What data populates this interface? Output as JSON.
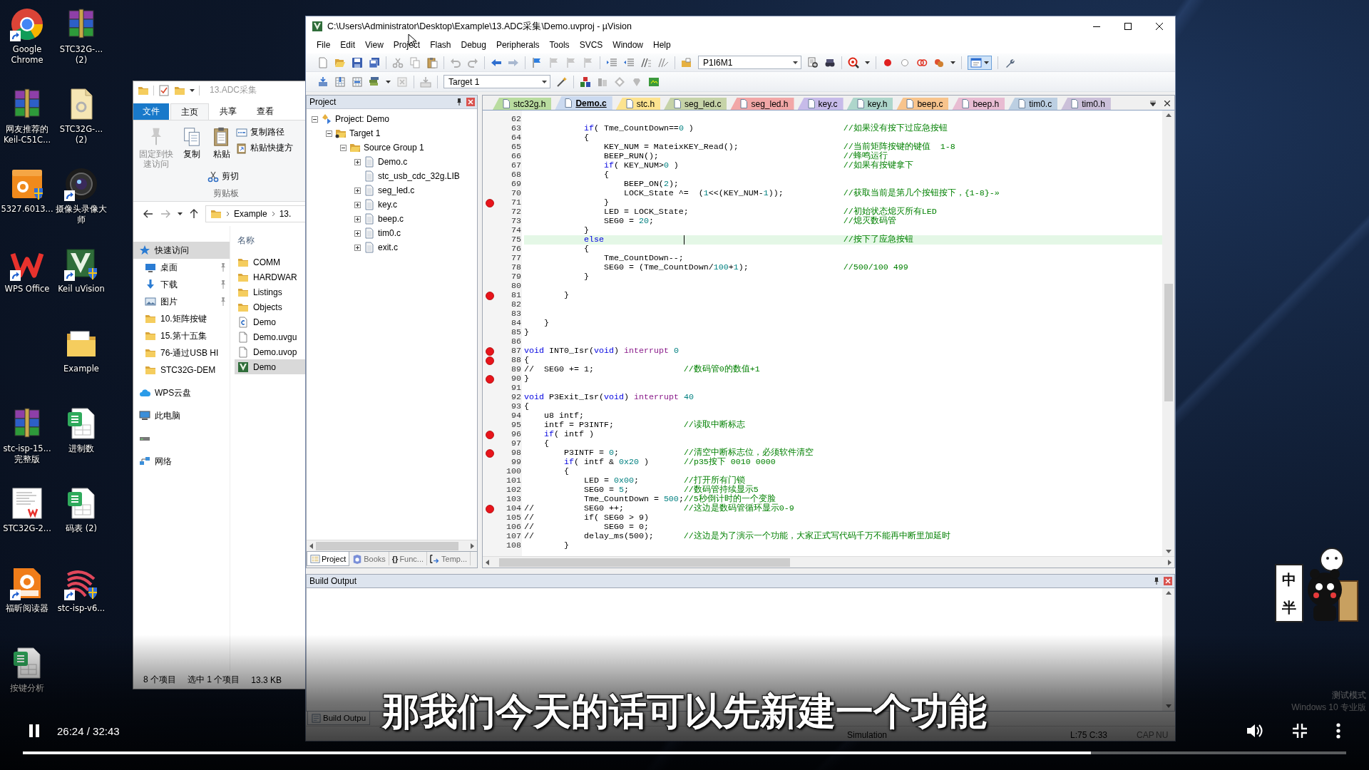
{
  "desktop": {
    "columns": [
      [
        {
          "label": "Google Chrome",
          "kind": "browser",
          "shortcut": true
        },
        {
          "label": "网友推荐的Keil-C51C...",
          "kind": "archive",
          "shortcut": false
        },
        {
          "label": "5327.6013...",
          "kind": "pdf-package",
          "shortcut": false
        },
        {
          "label": "WPS Office",
          "kind": "office",
          "shortcut": true
        },
        {
          "label": "stc-isp-15...完整版",
          "kind": "archive",
          "shortcut": false
        },
        {
          "label": "STC32G-2...",
          "kind": "pdf-document",
          "shortcut": false
        },
        {
          "label": "福昕阅读器",
          "kind": "reader",
          "shortcut": true
        },
        {
          "label": "按键分析",
          "kind": "spreadsheet",
          "shortcut": false
        }
      ],
      [
        {
          "label": "STC32G-... (2)",
          "kind": "archive",
          "shortcut": false
        },
        {
          "label": "STC32G-... (2)",
          "kind": "document",
          "shortcut": false
        },
        {
          "label": "摄像头录像大师",
          "kind": "camera",
          "shortcut": true
        },
        {
          "label": "Keil uVision",
          "kind": "ide",
          "shortcut": true
        },
        {
          "label": "Example",
          "kind": "folder",
          "shortcut": false
        },
        {
          "label": "进制数",
          "kind": "spreadsheet",
          "shortcut": false
        },
        {
          "label": "码表 (2)",
          "kind": "spreadsheet",
          "shortcut": false
        },
        {
          "label": "stc-isp-v6...",
          "kind": "tool",
          "shortcut": true
        }
      ]
    ],
    "os_notice": [
      "测试模式",
      "Windows 10 专业版"
    ]
  },
  "explorer": {
    "title": "13.ADC采集",
    "ribbon_tabs": [
      {
        "label": "文件",
        "kind": "menu",
        "selected": false
      },
      {
        "label": "主页",
        "kind": "tab",
        "selected": true
      },
      {
        "label": "共享",
        "kind": "tab",
        "selected": false
      },
      {
        "label": "查看",
        "kind": "tab",
        "selected": false
      }
    ],
    "ribbon": {
      "large": [
        {
          "label": "固定到快速访问",
          "kind": "pin",
          "disabled": true
        },
        {
          "label": "复制",
          "kind": "copy",
          "disabled": false
        },
        {
          "label": "粘贴",
          "kind": "paste",
          "disabled": false
        }
      ],
      "small": [
        {
          "label": "复制路径",
          "kind": "copy-path"
        },
        {
          "label": "粘贴快捷方",
          "kind": "paste-shortcut"
        },
        {
          "label": "剪切",
          "kind": "cut"
        }
      ],
      "group": "剪贴板"
    },
    "address": [
      "Example",
      "13."
    ],
    "nav": [
      {
        "label": "快速访问",
        "kind": "star",
        "selected": true,
        "children": [
          {
            "label": "桌面",
            "kind": "desktop",
            "pinned": true,
            "selected": false
          },
          {
            "label": "下载",
            "kind": "download",
            "pinned": true,
            "selected": false
          },
          {
            "label": "图片",
            "kind": "pictures",
            "pinned": true,
            "selected": false
          },
          {
            "label": "10.矩阵按键",
            "kind": "folder",
            "pinned": false,
            "selected": false
          },
          {
            "label": "15.第十五集",
            "kind": "folder",
            "pinned": false,
            "selected": false
          },
          {
            "label": "76-通过USB HI",
            "kind": "folder",
            "pinned": false,
            "selected": false
          },
          {
            "label": "STC32G-DEM",
            "kind": "folder",
            "pinned": false,
            "selected": false
          }
        ]
      },
      {
        "label": "WPS云盘",
        "kind": "cloud",
        "selected": false
      },
      {
        "label": "此电脑",
        "kind": "computer",
        "selected": false
      },
      {
        "kind": "drive",
        "selected": false
      },
      {
        "label": "网络",
        "kind": "network",
        "selected": false
      }
    ],
    "column": "名称",
    "files": [
      {
        "name": "COMM",
        "kind": "folder",
        "selected": false
      },
      {
        "name": "HARDWAR",
        "kind": "folder",
        "selected": false
      },
      {
        "name": "Listings",
        "kind": "folder",
        "selected": false
      },
      {
        "name": "Objects",
        "kind": "folder",
        "selected": false
      },
      {
        "name": "Demo",
        "kind": "c-source",
        "selected": false
      },
      {
        "name": "Demo.uvgu",
        "kind": "file",
        "selected": false
      },
      {
        "name": "Demo.uvop",
        "kind": "file",
        "selected": false
      },
      {
        "name": "Demo",
        "kind": "project",
        "selected": true
      }
    ],
    "status": [
      "8 个项目",
      "选中 1 个项目",
      "13.3 KB"
    ]
  },
  "uvision": {
    "title": "C:\\Users\\Administrator\\Desktop\\Example\\13.ADC采集\\Demo.uvproj - µVision",
    "menu": [
      "File",
      "Edit",
      "View",
      "Project",
      "Flash",
      "Debug",
      "Peripherals",
      "Tools",
      "SVCS",
      "Window",
      "Help"
    ],
    "toolbar": {
      "device": "P1I6M1",
      "target": "Target 1",
      "layout_pressed": true
    },
    "project": {
      "title": "Project",
      "tree": [
        {
          "label": "Project: Demo",
          "kind": "project",
          "expanded": true,
          "children": [
            {
              "label": "Target 1",
              "kind": "target",
              "expanded": true,
              "children": [
                {
                  "label": "Source Group 1",
                  "kind": "group",
                  "expanded": true,
                  "children": [
                    {
                      "label": "Demo.c",
                      "kind": "file",
                      "expandable": true,
                      "expanded": false
                    },
                    {
                      "label": "stc_usb_cdc_32g.LIB",
                      "kind": "file",
                      "expandable": false
                    },
                    {
                      "label": "seg_led.c",
                      "kind": "file",
                      "expandable": true,
                      "expanded": false
                    },
                    {
                      "label": "key.c",
                      "kind": "file",
                      "expandable": true,
                      "expanded": false
                    },
                    {
                      "label": "beep.c",
                      "kind": "file",
                      "expandable": true,
                      "expanded": false
                    },
                    {
                      "label": "tim0.c",
                      "kind": "file",
                      "expandable": true,
                      "expanded": false
                    },
                    {
                      "label": "exit.c",
                      "kind": "file",
                      "expandable": true,
                      "expanded": false
                    }
                  ]
                }
              ]
            }
          ]
        }
      ],
      "tabs": [
        {
          "label": "Project",
          "kind": "project",
          "selected": true
        },
        {
          "label": "Books",
          "kind": "books",
          "selected": false
        },
        {
          "label": "Func...",
          "kind": "functions",
          "glyph": "{}",
          "selected": false
        },
        {
          "label": "Temp...",
          "kind": "templates",
          "selected": false
        }
      ]
    },
    "editor": {
      "tabs": [
        {
          "label": "stc32g.h",
          "color": "#b9dc9f",
          "selected": false
        },
        {
          "label": "Demo.c",
          "color": "#cbdaf0",
          "selected": true
        },
        {
          "label": "stc.h",
          "color": "#fde38f",
          "selected": false
        },
        {
          "label": "seg_led.c",
          "color": "#c6d3a8",
          "selected": false
        },
        {
          "label": "seg_led.h",
          "color": "#f2a7a7",
          "selected": false
        },
        {
          "label": "key.c",
          "color": "#c7bbe9",
          "selected": false
        },
        {
          "label": "key.h",
          "color": "#aed6cb",
          "selected": false
        },
        {
          "label": "beep.c",
          "color": "#f8c48c",
          "selected": false
        },
        {
          "label": "beep.h",
          "color": "#e8bcd2",
          "selected": false
        },
        {
          "label": "tim0.c",
          "color": "#bccfe2",
          "selected": false
        },
        {
          "label": "tim0.h",
          "color": "#cbc0d9",
          "selected": false
        }
      ],
      "lines": [
        {
          "number": "62",
          "breakpoint": false,
          "current": false
        },
        {
          "number": "63",
          "breakpoint": false,
          "current": false,
          "tokens": [
            {
              "kind": "keyword",
              "text": "            if"
            },
            {
              "kind": "plain",
              "text": "( Tme_CountDown=="
            },
            {
              "kind": "number",
              "text": "0"
            },
            {
              "kind": "plain",
              "text": " )                              "
            },
            {
              "kind": "comment",
              "text": "//如果没有按下过应急按钮"
            }
          ]
        },
        {
          "number": "64",
          "breakpoint": false,
          "current": false,
          "tokens": [
            {
              "kind": "plain",
              "text": "            {"
            }
          ]
        },
        {
          "number": "65",
          "breakpoint": false,
          "current": false,
          "tokens": [
            {
              "kind": "plain",
              "text": "                KEY_NUM = MateixKEY_Read();                     "
            },
            {
              "kind": "comment",
              "text": "//当前矩阵按键的键值  1-8"
            }
          ]
        },
        {
          "number": "66",
          "breakpoint": false,
          "current": false,
          "tokens": [
            {
              "kind": "plain",
              "text": "                BEEP_RUN();                                     "
            },
            {
              "kind": "comment",
              "text": "//蜂鸣运行"
            }
          ]
        },
        {
          "number": "67",
          "breakpoint": false,
          "current": false,
          "tokens": [
            {
              "kind": "keyword",
              "text": "                if"
            },
            {
              "kind": "plain",
              "text": "( KEY_NUM>"
            },
            {
              "kind": "number",
              "text": "0"
            },
            {
              "kind": "plain",
              "text": " )                                 "
            },
            {
              "kind": "comment",
              "text": "//如果有按键拿下"
            }
          ]
        },
        {
          "number": "68",
          "breakpoint": false,
          "current": false,
          "tokens": [
            {
              "kind": "plain",
              "text": "                {"
            }
          ]
        },
        {
          "number": "69",
          "breakpoint": false,
          "current": false,
          "tokens": [
            {
              "kind": "plain",
              "text": "                    BEEP_ON("
            },
            {
              "kind": "number",
              "text": "2"
            },
            {
              "kind": "plain",
              "text": ");"
            }
          ]
        },
        {
          "number": "70",
          "breakpoint": false,
          "current": false,
          "tokens": [
            {
              "kind": "plain",
              "text": "                    LOCK_State ^=  ("
            },
            {
              "kind": "number",
              "text": "1"
            },
            {
              "kind": "plain",
              "text": "<<(KEY_NUM-"
            },
            {
              "kind": "number",
              "text": "1"
            },
            {
              "kind": "plain",
              "text": "));            "
            },
            {
              "kind": "comment",
              "text": "//获取当前是第几个按钮按下，{1-8}-»"
            }
          ]
        },
        {
          "number": "71",
          "breakpoint": true,
          "current": false,
          "tokens": [
            {
              "kind": "plain",
              "text": "                }"
            }
          ]
        },
        {
          "number": "72",
          "breakpoint": false,
          "current": false,
          "tokens": [
            {
              "kind": "plain",
              "text": "                LED = LOCK_State;                               "
            },
            {
              "kind": "comment",
              "text": "//初始状态熄灭所有LED"
            }
          ]
        },
        {
          "number": "73",
          "breakpoint": false,
          "current": false,
          "tokens": [
            {
              "kind": "plain",
              "text": "                SEG0 = "
            },
            {
              "kind": "number",
              "text": "20"
            },
            {
              "kind": "plain",
              "text": ";                                      "
            },
            {
              "kind": "comment",
              "text": "//熄灭数码管"
            }
          ]
        },
        {
          "number": "74",
          "breakpoint": false,
          "current": false,
          "tokens": [
            {
              "kind": "plain",
              "text": "            }"
            }
          ]
        },
        {
          "number": "75",
          "breakpoint": false,
          "current": true,
          "tokens": [
            {
              "kind": "keyword",
              "text": "            else"
            },
            {
              "kind": "comment",
              "text": "                                                //按下了应急按钮"
            }
          ]
        },
        {
          "number": "76",
          "breakpoint": false,
          "current": false,
          "tokens": [
            {
              "kind": "plain",
              "text": "            {"
            }
          ]
        },
        {
          "number": "77",
          "breakpoint": false,
          "current": false,
          "tokens": [
            {
              "kind": "plain",
              "text": "                Tme_CountDown--;"
            }
          ]
        },
        {
          "number": "78",
          "breakpoint": false,
          "current": false,
          "tokens": [
            {
              "kind": "plain",
              "text": "                SEG0 = (Tme_CountDown/"
            },
            {
              "kind": "number",
              "text": "100"
            },
            {
              "kind": "plain",
              "text": "+"
            },
            {
              "kind": "number",
              "text": "1"
            },
            {
              "kind": "plain",
              "text": ");                   "
            },
            {
              "kind": "comment",
              "text": "//500/100 499"
            }
          ]
        },
        {
          "number": "79",
          "breakpoint": false,
          "current": false,
          "tokens": [
            {
              "kind": "plain",
              "text": "            }"
            }
          ]
        },
        {
          "number": "80",
          "breakpoint": false,
          "current": false
        },
        {
          "number": "81",
          "breakpoint": true,
          "current": false,
          "tokens": [
            {
              "kind": "plain",
              "text": "        }"
            }
          ]
        },
        {
          "number": "82",
          "breakpoint": false,
          "current": false
        },
        {
          "number": "83",
          "breakpoint": false,
          "current": false
        },
        {
          "number": "84",
          "breakpoint": false,
          "current": false,
          "tokens": [
            {
              "kind": "plain",
              "text": "    }"
            }
          ]
        },
        {
          "number": "85",
          "breakpoint": false,
          "current": false,
          "tokens": [
            {
              "kind": "plain",
              "text": "}"
            }
          ]
        },
        {
          "number": "86",
          "breakpoint": false,
          "current": false
        },
        {
          "number": "87",
          "breakpoint": true,
          "current": false,
          "tokens": [
            {
              "kind": "keyword",
              "text": "void"
            },
            {
              "kind": "plain",
              "text": " INT0_Isr("
            },
            {
              "kind": "keyword",
              "text": "void"
            },
            {
              "kind": "plain",
              "text": ") "
            },
            {
              "kind": "directive",
              "text": "interrupt"
            },
            {
              "kind": "number",
              "text": " 0"
            }
          ]
        },
        {
          "number": "88",
          "breakpoint": true,
          "current": false,
          "tokens": [
            {
              "kind": "plain",
              "text": "{"
            }
          ]
        },
        {
          "number": "89",
          "breakpoint": false,
          "current": false,
          "tokens": [
            {
              "kind": "plain",
              "text": "//  SEG0 += 1;                  "
            },
            {
              "kind": "comment",
              "text": "//数码管0的数值+1"
            }
          ]
        },
        {
          "number": "90",
          "breakpoint": true,
          "current": false,
          "tokens": [
            {
              "kind": "plain",
              "text": "}"
            }
          ]
        },
        {
          "number": "91",
          "breakpoint": false,
          "current": false
        },
        {
          "number": "92",
          "breakpoint": false,
          "current": false,
          "tokens": [
            {
              "kind": "keyword",
              "text": "void"
            },
            {
              "kind": "plain",
              "text": " P3Exit_Isr("
            },
            {
              "kind": "keyword",
              "text": "void"
            },
            {
              "kind": "plain",
              "text": ") "
            },
            {
              "kind": "directive",
              "text": "interrupt"
            },
            {
              "kind": "number",
              "text": " 40"
            }
          ]
        },
        {
          "number": "93",
          "breakpoint": false,
          "current": false,
          "tokens": [
            {
              "kind": "plain",
              "text": "{"
            }
          ]
        },
        {
          "number": "94",
          "breakpoint": false,
          "current": false,
          "tokens": [
            {
              "kind": "plain",
              "text": "    u8 intf;"
            }
          ]
        },
        {
          "number": "95",
          "breakpoint": false,
          "current": false,
          "tokens": [
            {
              "kind": "plain",
              "text": "    intf = P3INTF;              "
            },
            {
              "kind": "comment",
              "text": "//读取中断标志"
            }
          ]
        },
        {
          "number": "96",
          "breakpoint": true,
          "current": false,
          "tokens": [
            {
              "kind": "keyword",
              "text": "    if"
            },
            {
              "kind": "plain",
              "text": "( intf )"
            }
          ]
        },
        {
          "number": "97",
          "breakpoint": false,
          "current": false,
          "tokens": [
            {
              "kind": "plain",
              "text": "    {"
            }
          ]
        },
        {
          "number": "98",
          "breakpoint": true,
          "current": false,
          "tokens": [
            {
              "kind": "plain",
              "text": "        P3INTF = "
            },
            {
              "kind": "number",
              "text": "0"
            },
            {
              "kind": "plain",
              "text": ";             "
            },
            {
              "kind": "comment",
              "text": "//清空中断标志位，必须软件清空"
            }
          ]
        },
        {
          "number": "99",
          "breakpoint": false,
          "current": false,
          "tokens": [
            {
              "kind": "keyword",
              "text": "        if"
            },
            {
              "kind": "plain",
              "text": "( intf & "
            },
            {
              "kind": "number",
              "text": "0x20"
            },
            {
              "kind": "plain",
              "text": " )       "
            },
            {
              "kind": "comment",
              "text": "//p35按下 0010 0000"
            }
          ]
        },
        {
          "number": "100",
          "breakpoint": false,
          "current": false,
          "tokens": [
            {
              "kind": "plain",
              "text": "        {"
            }
          ]
        },
        {
          "number": "101",
          "breakpoint": false,
          "current": false,
          "tokens": [
            {
              "kind": "plain",
              "text": "            LED = "
            },
            {
              "kind": "number",
              "text": "0x00"
            },
            {
              "kind": "plain",
              "text": ";         "
            },
            {
              "kind": "comment",
              "text": "//打开所有门锁"
            }
          ]
        },
        {
          "number": "102",
          "breakpoint": false,
          "current": false,
          "tokens": [
            {
              "kind": "plain",
              "text": "            SEG0 = "
            },
            {
              "kind": "number",
              "text": "5"
            },
            {
              "kind": "plain",
              "text": ";           "
            },
            {
              "kind": "comment",
              "text": "//数码管持续显示5"
            }
          ]
        },
        {
          "number": "103",
          "breakpoint": false,
          "current": false,
          "tokens": [
            {
              "kind": "plain",
              "text": "            Tme_CountDown = "
            },
            {
              "kind": "number",
              "text": "500"
            },
            {
              "kind": "plain",
              "text": ";"
            },
            {
              "kind": "comment",
              "text": "//5秒倒计时的一个变脸"
            }
          ]
        },
        {
          "number": "104",
          "breakpoint": true,
          "current": false,
          "tokens": [
            {
              "kind": "plain",
              "text": "//          SEG0 ++;            "
            },
            {
              "kind": "comment",
              "text": "//这边是数码管循环显示0-9"
            }
          ]
        },
        {
          "number": "105",
          "breakpoint": false,
          "current": false,
          "tokens": [
            {
              "kind": "plain",
              "text": "//          if( SEG0 > 9)"
            }
          ]
        },
        {
          "number": "106",
          "breakpoint": false,
          "current": false,
          "tokens": [
            {
              "kind": "plain",
              "text": "//              SEG0 = 0;"
            }
          ]
        },
        {
          "number": "107",
          "breakpoint": false,
          "current": false,
          "tokens": [
            {
              "kind": "plain",
              "text": "//          delay_ms(500);      "
            },
            {
              "kind": "comment",
              "text": "//这边是为了演示一个功能，大家正式写代码千万不能再中断里加延时"
            }
          ]
        },
        {
          "number": "108",
          "breakpoint": false,
          "current": false,
          "tokens": [
            {
              "kind": "plain",
              "text": "        }"
            }
          ]
        }
      ]
    },
    "build_output": {
      "title": "Build Output",
      "tab": "Build Outpu"
    },
    "status_bar": [
      "Simulation",
      "L:75 C:33",
      "CAP",
      "NU"
    ]
  },
  "player": {
    "subtitle": "那我们今天的话可以先新建一个功能",
    "playing": true,
    "time": "26:24 / 32:43",
    "progress": {
      "level": 0.807
    },
    "sticker": [
      "中",
      "半"
    ]
  }
}
